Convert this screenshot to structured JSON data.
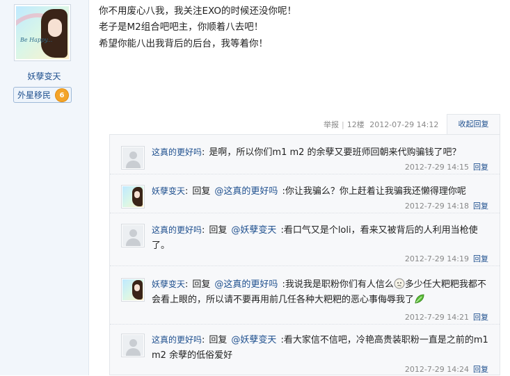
{
  "author": {
    "username": "妖孽变天",
    "rank_label": "外星移民",
    "level": "6",
    "avatar_text": "Be Happy...",
    "avatar": "user-avatar-girl-rainbow"
  },
  "post": {
    "lines": [
      "你不用废心八我，我关注EXO的时候还没你呢！",
      "老子是M2组合吧吧主，你顺着八去吧！",
      "希望你能八出我背后的后台，我等着你！"
    ],
    "report_label": "举报",
    "floor": "12楼",
    "datetime": "2012-07-29 14:12",
    "collapse_reply_label": "收起回复"
  },
  "replies": [
    {
      "user": "这真的更好吗",
      "colon": ":",
      "reply_word": "",
      "target": "",
      "text": "是啊，所以你们m1 m2 的余孽又要班师回朝来代购骗钱了吧？",
      "time": "2012-7-29 14:15",
      "reply_label": "回复",
      "avatar": "default-avatar"
    },
    {
      "user": "妖孽变天",
      "colon": ":",
      "reply_word": "回复",
      "target": "@这真的更好吗",
      "text": ":你让我骗么？你上赶着让我骗我还懒得理你呢",
      "time": "2012-7-29 14:18",
      "reply_label": "回复",
      "avatar": "user-avatar-girl-rainbow"
    },
    {
      "user": "这真的更好吗",
      "colon": ":",
      "reply_word": "回复",
      "target": "@妖孽变天",
      "text": ":看口气又是个loli，看来又被背后的人利用当枪使了。",
      "time": "2012-7-29 14:19",
      "reply_label": "回复",
      "avatar": "default-avatar"
    },
    {
      "user": "妖孽变天",
      "colon": ":",
      "reply_word": "回复",
      "target": "@这真的更好吗",
      "text_a": ":我说我是职粉你们有人信么",
      "text_b": "多少任大粑粑我都不会看上眼的，所以请不要再用前几任各种大粑粑的恶心事侮辱我了",
      "time": "2012-7-29 14:21",
      "reply_label": "回复",
      "avatar": "user-avatar-girl-rainbow",
      "emoji_1": "thinking-face-emoji",
      "emoji_2": "green-leaf-emoji"
    },
    {
      "user": "这真的更好吗",
      "colon": ":",
      "reply_word": "回复",
      "target": "@妖孽变天",
      "text": ":看大家信不信吧，冷艳高贵装职粉一直是之前的m1 m2 余孽的低俗爱好",
      "time": "2012-7-29 14:24",
      "reply_label": "回复",
      "avatar": "default-avatar"
    }
  ]
}
